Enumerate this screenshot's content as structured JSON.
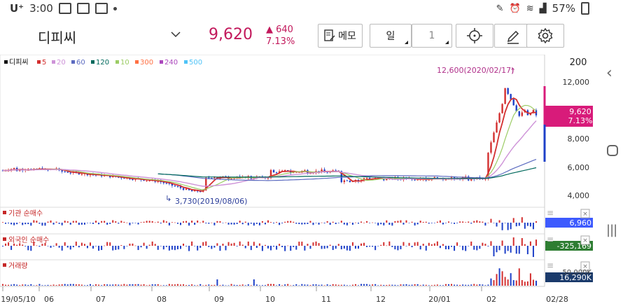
{
  "status_bar": {
    "carrier": "U⁺",
    "time": "3:00",
    "battery": "57%"
  },
  "toolbar": {
    "stock_name": "디피씨",
    "price": "9,620",
    "change_amount": "640",
    "change_percent": "7.13%",
    "memo_label": "메모",
    "period_label": "일",
    "period_count": "1"
  },
  "legend": [
    {
      "label": "디피씨",
      "color": "#111111"
    },
    {
      "label": "5",
      "color": "#d32f2f"
    },
    {
      "label": "20",
      "color": "#ce93d8"
    },
    {
      "label": "60",
      "color": "#5c6bc0"
    },
    {
      "label": "120",
      "color": "#00695c"
    },
    {
      "label": "10",
      "color": "#9ccc65"
    },
    {
      "label": "300",
      "color": "#ff7043"
    },
    {
      "label": "240",
      "color": "#ab47bc"
    },
    {
      "label": "500",
      "color": "#4fc3f7"
    }
  ],
  "price_axis": {
    "top_label": "200",
    "ticks": [
      "12,000",
      "10,000",
      "8,000",
      "6,000",
      "4,000"
    ]
  },
  "current_price_tag": {
    "price": "9,620",
    "percent": "7.13%"
  },
  "annotations": {
    "high": "12,600(2020/02/17)",
    "low": "3,730(2019/08/06)"
  },
  "panels": [
    {
      "title": "기관 순매수",
      "value": "6,960",
      "value_color": "#3d5afe"
    },
    {
      "title": "외국인 순매수",
      "value": "-325,169",
      "value_color": "#2e7d32"
    },
    {
      "title": "거래량",
      "value": "16,290K",
      "value_color": "#1a3a6b",
      "scale": "50,000K"
    }
  ],
  "x_axis": [
    "19/05/10",
    "06",
    "07",
    "08",
    "09",
    "10",
    "11",
    "12",
    "20/01",
    "02",
    "02/28"
  ],
  "colors": {
    "up": "#d32f2f",
    "down": "#1e40c8",
    "accent": "#c2185b"
  }
}
